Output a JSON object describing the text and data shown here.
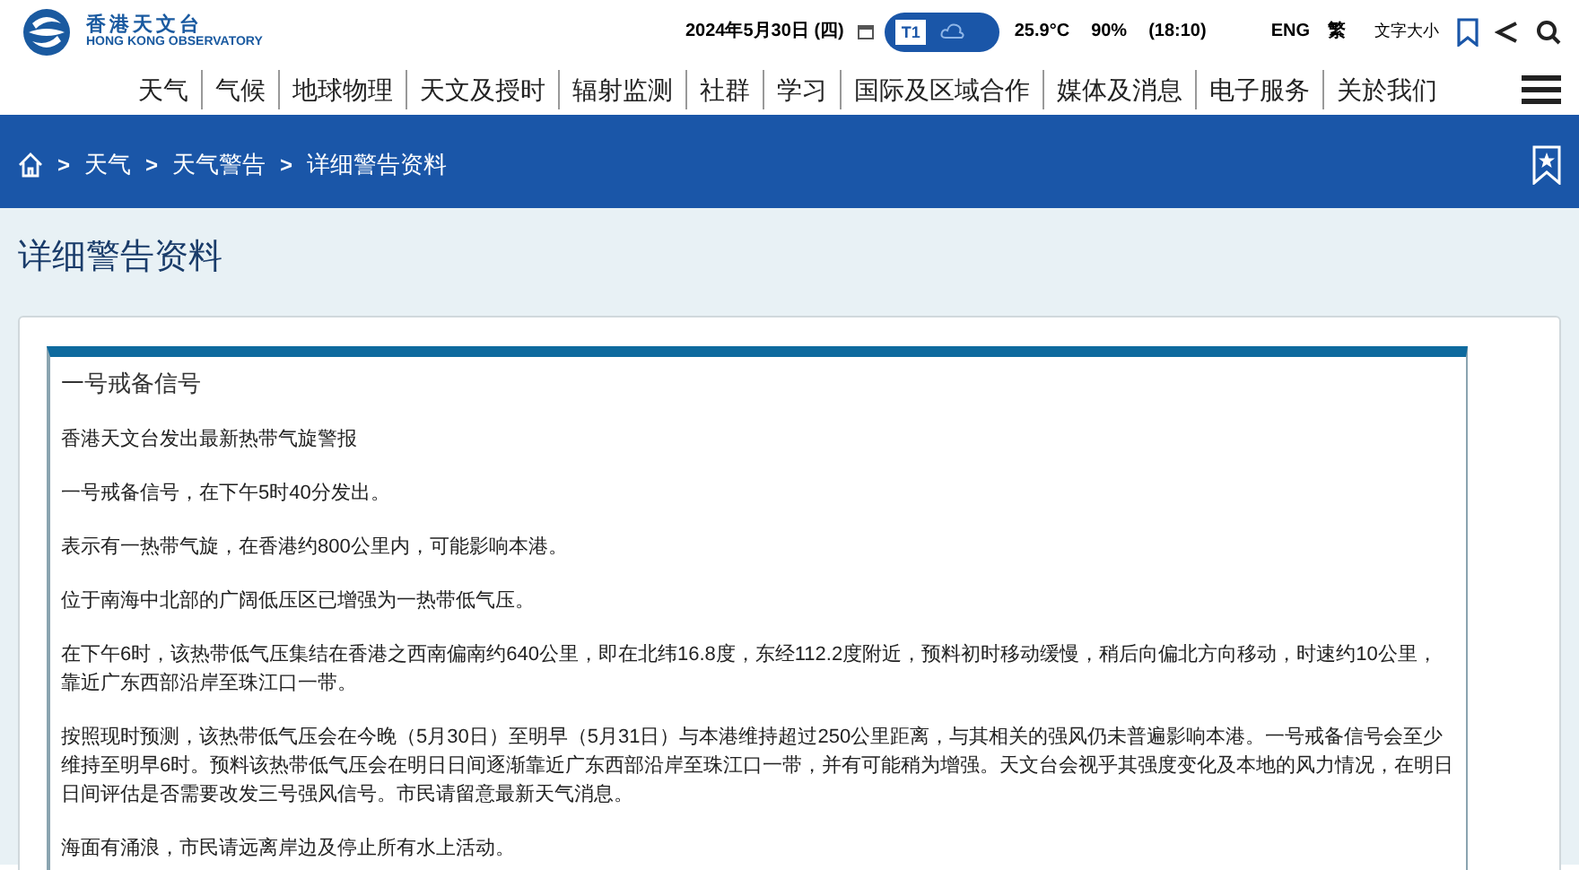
{
  "header": {
    "logo_title": "香港天文台",
    "logo_subtitle": "HONG KONG OBSERVATORY",
    "date": "2024年5月30日 (四)",
    "signal": "T1",
    "temperature": "25.9°C",
    "humidity": "90%",
    "time": "(18:10)",
    "languages": [
      "ENG",
      "繁"
    ],
    "font_size": "文字大小"
  },
  "nav": [
    "天气",
    "气候",
    "地球物理",
    "天文及授时",
    "辐射监测",
    "社群",
    "学习",
    "国际及区域合作",
    "媒体及消息",
    "电子服务",
    "关於我们"
  ],
  "breadcrumb": [
    {
      "separator": ">",
      "label": "天气"
    },
    {
      "separator": ">",
      "label": "天气警告"
    },
    {
      "separator": ">",
      "label": "详细警告资料"
    }
  ],
  "page_title": "详细警告资料",
  "warning": {
    "title": "一号戒备信号",
    "paragraphs": [
      "香港天文台发出最新热带气旋警报",
      "一号戒备信号，在下午5时40分发出。",
      "表示有一热带气旋，在香港约800公里内，可能影响本港。",
      "位于南海中北部的广阔低压区已增强为一热带低气压。",
      "在下午6时，该热带低气压集结在香港之西南偏南约640公里，即在北纬16.8度，东经112.2度附近，预料初时移动缓慢，稍后向偏北方向移动，时速约10公里，靠近广东西部沿岸至珠江口一带。",
      "按照现时预测，该热带低气压会在今晚（5月30日）至明早（5月31日）与本港维持超过250公里距离，与其相关的强风仍未普遍影响本港。一号戒备信号会至少维持至明早6时。预料该热带低气压会在明日日间逐渐靠近广东西部沿岸至珠江口一带，并有可能稍为增强。天文台会视乎其强度变化及本地的风力情况，在明日日间评估是否需要改发三号强风信号。市民请留意最新天气消息。",
      "海面有涌浪，市民请远离岸边及停止所有水上活动。"
    ]
  }
}
